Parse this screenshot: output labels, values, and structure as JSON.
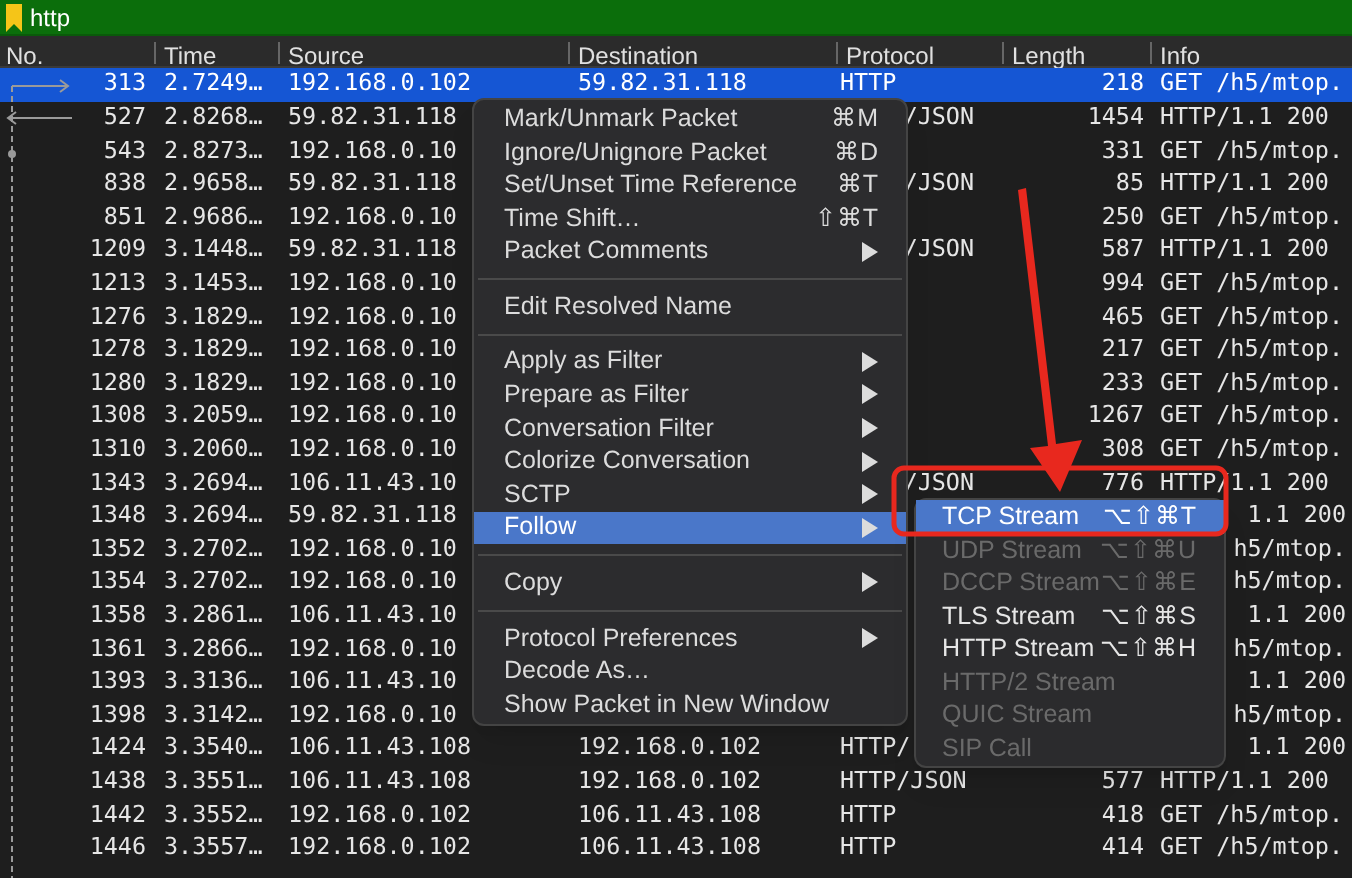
{
  "filter": {
    "value": "http"
  },
  "columns": [
    "No.",
    "Time",
    "Source",
    "Destination",
    "Protocol",
    "Length",
    "Info"
  ],
  "rows": [
    {
      "selected": true,
      "under_menu": false,
      "under_submenu": false,
      "no": "313",
      "time": "2.7249…",
      "source": "192.168.0.102",
      "destination": "59.82.31.118",
      "protocol": "HTTP",
      "length": "218",
      "info": "GET /h5/mtop."
    },
    {
      "selected": false,
      "under_menu": true,
      "under_submenu": false,
      "no": "527",
      "time": "2.8268…",
      "source": "59.82.31.118",
      "protocol": "/JSON",
      "length": "1454",
      "info": "HTTP/1.1 200"
    },
    {
      "selected": false,
      "under_submenu": false,
      "no": "543",
      "time": "2.8273…",
      "source": "192.168.0.10",
      "length": "331",
      "info": "GET /h5/mtop."
    },
    {
      "selected": false,
      "under_menu": true,
      "under_submenu": false,
      "no": "838",
      "time": "2.9658…",
      "source": "59.82.31.118",
      "protocol": "/JSON",
      "length": "85",
      "info": "HTTP/1.1 200"
    },
    {
      "selected": false,
      "under_submenu": false,
      "no": "851",
      "time": "2.9686…",
      "source": "192.168.0.10",
      "length": "250",
      "info": "GET /h5/mtop."
    },
    {
      "selected": false,
      "under_menu": true,
      "under_submenu": false,
      "no": "1209",
      "time": "3.1448…",
      "source": "59.82.31.118",
      "protocol": "/JSON",
      "length": "587",
      "info": "HTTP/1.1 200"
    },
    {
      "selected": false,
      "under_submenu": false,
      "no": "1213",
      "time": "3.1453…",
      "source": "192.168.0.10",
      "length": "994",
      "info": "GET /h5/mtop."
    },
    {
      "selected": false,
      "under_submenu": false,
      "no": "1276",
      "time": "3.1829…",
      "source": "192.168.0.10",
      "length": "465",
      "info": "GET /h5/mtop."
    },
    {
      "selected": false,
      "under_submenu": false,
      "no": "1278",
      "time": "3.1829…",
      "source": "192.168.0.10",
      "length": "217",
      "info": "GET /h5/mtop."
    },
    {
      "selected": false,
      "under_submenu": false,
      "no": "1280",
      "time": "3.1829…",
      "source": "192.168.0.10",
      "length": "233",
      "info": "GET /h5/mtop."
    },
    {
      "selected": false,
      "under_submenu": false,
      "no": "1308",
      "time": "3.2059…",
      "source": "192.168.0.10",
      "length": "1267",
      "info": "GET /h5/mtop."
    },
    {
      "selected": false,
      "under_submenu": false,
      "no": "1310",
      "time": "3.2060…",
      "source": "192.168.0.10",
      "length": "308",
      "info": "GET /h5/mtop."
    },
    {
      "selected": false,
      "under_menu": true,
      "under_submenu": false,
      "no": "1343",
      "time": "3.2694…",
      "source": "106.11.43.10",
      "protocol": "/JSON",
      "length": "776",
      "info": "HTTP/1.1 200"
    },
    {
      "selected": false,
      "under_submenu": true,
      "no": "1348",
      "time": "3.2694…",
      "source": "59.82.31.118",
      "info": "1.1 200"
    },
    {
      "selected": false,
      "under_submenu": true,
      "no": "1352",
      "time": "3.2702…",
      "source": "192.168.0.10",
      "info": "h5/mtop."
    },
    {
      "selected": false,
      "under_submenu": true,
      "no": "1354",
      "time": "3.2702…",
      "source": "192.168.0.10",
      "info": "h5/mtop."
    },
    {
      "selected": false,
      "under_submenu": true,
      "no": "1358",
      "time": "3.2861…",
      "source": "106.11.43.10",
      "info": "1.1 200"
    },
    {
      "selected": false,
      "under_submenu": true,
      "no": "1361",
      "time": "3.2866…",
      "source": "192.168.0.10",
      "info": "h5/mtop."
    },
    {
      "selected": false,
      "under_submenu": true,
      "no": "1393",
      "time": "3.3136…",
      "source": "106.11.43.10",
      "info": "1.1 200"
    },
    {
      "selected": false,
      "under_submenu": true,
      "no": "1398",
      "time": "3.3142…",
      "source": "192.168.0.10",
      "info": "h5/mtop."
    },
    {
      "selected": false,
      "under_menu": false,
      "under_submenu": true,
      "no": "1424",
      "time": "3.3540…",
      "source": "106.11.43.108",
      "destination": "192.168.0.102",
      "protocol": "HTTP/",
      "info": "1.1 200"
    },
    {
      "selected": false,
      "under_menu": false,
      "under_submenu": false,
      "no": "1438",
      "time": "3.3551…",
      "source": "106.11.43.108",
      "destination": "192.168.0.102",
      "protocol": "HTTP/JSON",
      "length": "577",
      "info": "HTTP/1.1 200"
    },
    {
      "selected": false,
      "under_menu": false,
      "under_submenu": false,
      "no": "1442",
      "time": "3.3552…",
      "source": "192.168.0.102",
      "destination": "106.11.43.108",
      "protocol": "HTTP",
      "length": "418",
      "info": "GET /h5/mtop."
    },
    {
      "selected": false,
      "under_menu": false,
      "under_submenu": false,
      "no": "1446",
      "time": "3.3557…",
      "source": "192.168.0.102",
      "destination": "106.11.43.108",
      "protocol": "HTTP",
      "length": "414",
      "info": "GET /h5/mtop."
    }
  ],
  "context_menu": [
    {
      "kind": "item",
      "label": "Mark/Unmark Packet",
      "shortcut": "⌘M",
      "submenu": false,
      "selected": false
    },
    {
      "kind": "item",
      "label": "Ignore/Unignore Packet",
      "shortcut": "⌘D",
      "submenu": false,
      "selected": false
    },
    {
      "kind": "item",
      "label": "Set/Unset Time Reference",
      "shortcut": "⌘T",
      "submenu": false,
      "selected": false
    },
    {
      "kind": "item",
      "label": "Time Shift…",
      "shortcut": "⇧⌘T",
      "submenu": false,
      "selected": false
    },
    {
      "kind": "item",
      "label": "Packet Comments",
      "submenu": true,
      "selected": false
    },
    {
      "kind": "separator"
    },
    {
      "kind": "item",
      "label": "Edit Resolved Name",
      "submenu": false,
      "selected": false
    },
    {
      "kind": "separator"
    },
    {
      "kind": "item",
      "label": "Apply as Filter",
      "submenu": true,
      "selected": false
    },
    {
      "kind": "item",
      "label": "Prepare as Filter",
      "submenu": true,
      "selected": false
    },
    {
      "kind": "item",
      "label": "Conversation Filter",
      "submenu": true,
      "selected": false
    },
    {
      "kind": "item",
      "label": "Colorize Conversation",
      "submenu": true,
      "selected": false
    },
    {
      "kind": "item",
      "label": "SCTP",
      "submenu": true,
      "selected": false
    },
    {
      "kind": "item",
      "label": "Follow",
      "submenu": true,
      "selected": true
    },
    {
      "kind": "separator"
    },
    {
      "kind": "item",
      "label": "Copy",
      "submenu": true,
      "selected": false
    },
    {
      "kind": "separator"
    },
    {
      "kind": "item",
      "label": "Protocol Preferences",
      "submenu": true,
      "selected": false
    },
    {
      "kind": "item",
      "label": "Decode As…",
      "submenu": false,
      "selected": false
    },
    {
      "kind": "item",
      "label": "Show Packet in New Window",
      "submenu": false,
      "selected": false
    }
  ],
  "follow_submenu": [
    {
      "label": "TCP Stream",
      "shortcut": "⌥⇧⌘T",
      "selected": true,
      "disabled": false
    },
    {
      "label": "UDP Stream",
      "shortcut": "⌥⇧⌘U",
      "selected": false,
      "disabled": true
    },
    {
      "label": "DCCP Stream",
      "shortcut": "⌥⇧⌘E",
      "selected": false,
      "disabled": true
    },
    {
      "label": "TLS Stream",
      "shortcut": "⌥⇧⌘S",
      "selected": false,
      "disabled": false
    },
    {
      "label": "HTTP Stream",
      "shortcut": "⌥⇧⌘H",
      "selected": false,
      "disabled": false
    },
    {
      "label": "HTTP/2 Stream",
      "selected": false,
      "disabled": true
    },
    {
      "label": "QUIC Stream",
      "selected": false,
      "disabled": true
    },
    {
      "label": "SIP Call",
      "selected": false,
      "disabled": true
    }
  ]
}
